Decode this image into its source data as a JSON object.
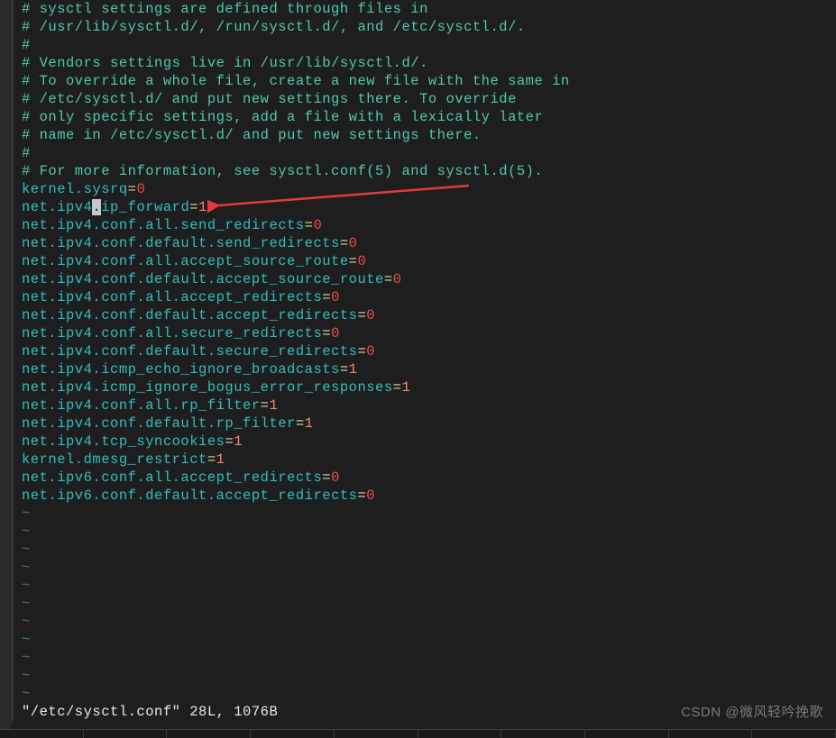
{
  "comments": [
    "# sysctl settings are defined through files in",
    "# /usr/lib/sysctl.d/, /run/sysctl.d/, and /etc/sysctl.d/.",
    "#",
    "# Vendors settings live in /usr/lib/sysctl.d/.",
    "# To override a whole file, create a new file with the same in",
    "# /etc/sysctl.d/ and put new settings there. To override",
    "# only specific settings, add a file with a lexically later",
    "# name in /etc/sysctl.d/ and put new settings there.",
    "#",
    "# For more information, see sysctl.conf(5) and sysctl.d(5)."
  ],
  "settings": [
    {
      "key": "kernel.sysrq",
      "value": "0",
      "vclass": "val0"
    },
    {
      "key": "net.ipv4.ip_forward",
      "value": "1",
      "vclass": "val1",
      "cursor_at": 8
    },
    {
      "key": "net.ipv4.conf.all.send_redirects",
      "value": "0",
      "vclass": "val0"
    },
    {
      "key": "net.ipv4.conf.default.send_redirects",
      "value": "0",
      "vclass": "val0"
    },
    {
      "key": "net.ipv4.conf.all.accept_source_route",
      "value": "0",
      "vclass": "val0"
    },
    {
      "key": "net.ipv4.conf.default.accept_source_route",
      "value": "0",
      "vclass": "val0"
    },
    {
      "key": "net.ipv4.conf.all.accept_redirects",
      "value": "0",
      "vclass": "val0"
    },
    {
      "key": "net.ipv4.conf.default.accept_redirects",
      "value": "0",
      "vclass": "val0"
    },
    {
      "key": "net.ipv4.conf.all.secure_redirects",
      "value": "0",
      "vclass": "val0"
    },
    {
      "key": "net.ipv4.conf.default.secure_redirects",
      "value": "0",
      "vclass": "val0"
    },
    {
      "key": "net.ipv4.icmp_echo_ignore_broadcasts",
      "value": "1",
      "vclass": "val1"
    },
    {
      "key": "net.ipv4.icmp_ignore_bogus_error_responses",
      "value": "1",
      "vclass": "val1"
    },
    {
      "key": "net.ipv4.conf.all.rp_filter",
      "value": "1",
      "vclass": "val1"
    },
    {
      "key": "net.ipv4.conf.default.rp_filter",
      "value": "1",
      "vclass": "val1"
    },
    {
      "key": "net.ipv4.tcp_syncookies",
      "value": "1",
      "vclass": "val1"
    },
    {
      "key": "kernel.dmesg_restrict",
      "value": "1",
      "vclass": "val1"
    },
    {
      "key": "net.ipv6.conf.all.accept_redirects",
      "value": "0",
      "vclass": "val0"
    },
    {
      "key": "net.ipv6.conf.default.accept_redirects",
      "value": "0",
      "vclass": "val0"
    }
  ],
  "tilde": "~",
  "empty_tilde_lines": 11,
  "status_line": "\"/etc/sysctl.conf\" 28L, 1076B",
  "watermark": "CSDN @微风轻吟挽歌"
}
